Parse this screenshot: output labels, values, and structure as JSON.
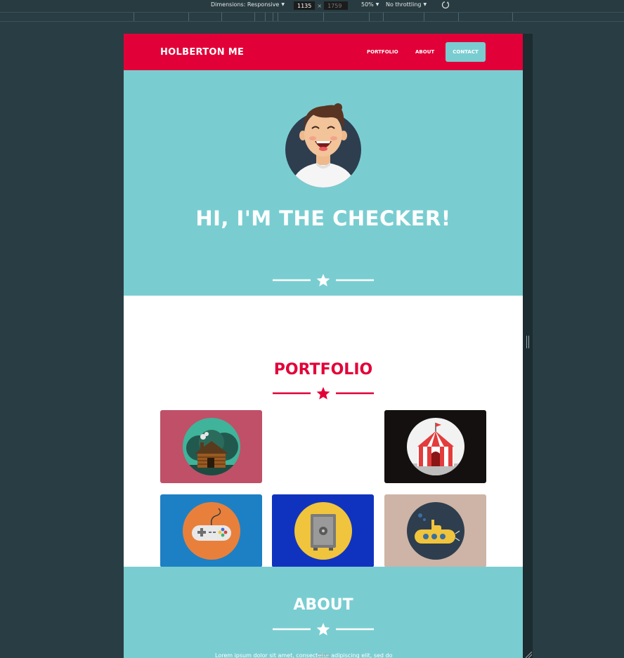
{
  "devtools": {
    "dimensions_label": "Dimensions: Responsive",
    "width_value": "1135",
    "height_value": "1759",
    "zoom": "50%",
    "throttling": "No throttling"
  },
  "nav": {
    "brand": "HOLBERTON ME",
    "links": [
      "PORTFOLIO",
      "ABOUT"
    ],
    "contact": "CONTACT"
  },
  "hero": {
    "title": "HI, I'M THE CHECKER!"
  },
  "portfolio": {
    "title": "PORTFOLIO",
    "tiles": [
      {
        "icon": "cabin-icon",
        "bg": "#bf5068"
      },
      {
        "icon": "circus-tent-icon",
        "bg": "#151010"
      },
      {
        "icon": "game-controller-icon",
        "bg": "#1d80c4"
      },
      {
        "icon": "safe-icon",
        "bg": "#1033bf"
      },
      {
        "icon": "submarine-icon",
        "bg": "#cdb4a6"
      }
    ]
  },
  "about": {
    "title": "ABOUT",
    "text": "Lorem ipsum dolor sit amet, consectetur adipiscing elit, sed do"
  },
  "colors": {
    "brand_red": "#e20038",
    "teal": "#79cdd1",
    "devtools_bg": "#283e44"
  }
}
